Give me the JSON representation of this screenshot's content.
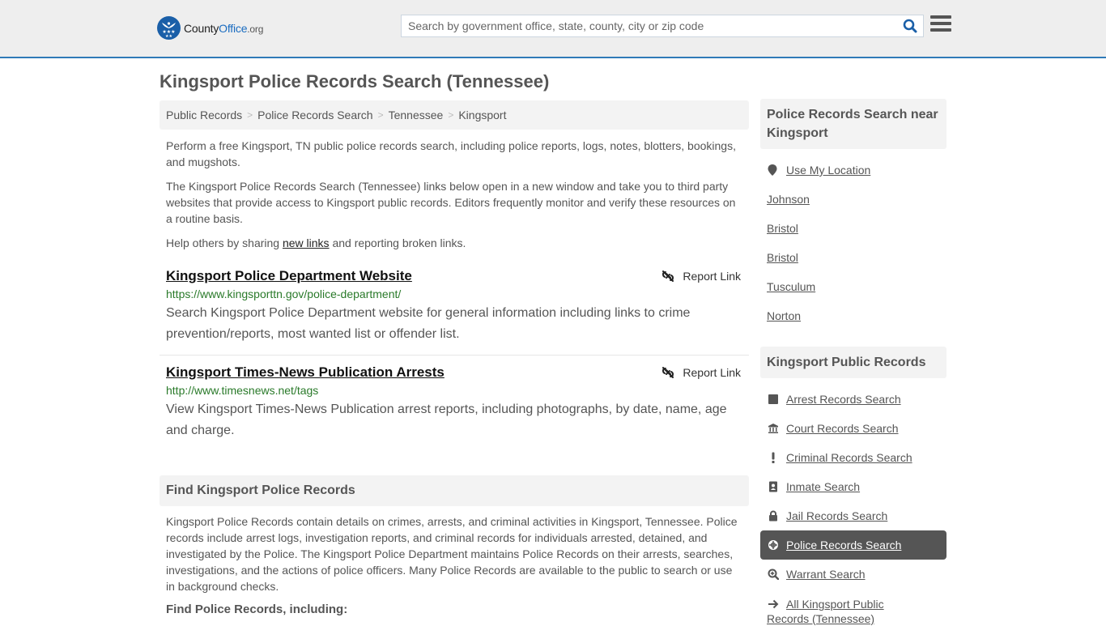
{
  "header": {
    "logo": {
      "county": "County",
      "office": "Office",
      "org": ".org"
    },
    "search": {
      "placeholder": "Search by government office, state, county, city or zip code",
      "value": ""
    },
    "brand_color": "#1a5fa8",
    "accent_border": "#2f7ab8"
  },
  "page": {
    "title": "Kingsport Police Records Search (Tennessee)"
  },
  "breadcrumb": [
    {
      "label": "Public Records"
    },
    {
      "label": "Police Records Search"
    },
    {
      "label": "Tennessee"
    },
    {
      "label": "Kingsport"
    }
  ],
  "breadcrumb_separator": ">",
  "intro": {
    "p1": "Perform a free Kingsport, TN public police records search, including police reports, logs, notes, blotters, bookings, and mugshots.",
    "p2": "The Kingsport Police Records Search (Tennessee) links below open in a new window and take you to third party websites that provide access to Kingsport public records. Editors frequently monitor and verify these resources on a routine basis.",
    "p3_before": "Help others by sharing ",
    "p3_link": "new links",
    "p3_after": " and reporting broken links."
  },
  "results": [
    {
      "title": "Kingsport Police Department Website",
      "url": "https://www.kingsporttn.gov/police-department/",
      "description": "Search Kingsport Police Department website for general information including links to crime prevention/reports, most wanted list or offender list.",
      "report_label": "Report Link"
    },
    {
      "title": "Kingsport Times-News Publication Arrests",
      "url": "http://www.timesnews.net/tags",
      "description": "View Kingsport Times-News Publication arrest reports, including photographs, by date, name, age and charge.",
      "report_label": "Report Link"
    }
  ],
  "find_section": {
    "heading": "Find Kingsport Police Records",
    "body": "Kingsport Police Records contain details on crimes, arrests, and criminal activities in Kingsport, Tennessee. Police records include arrest logs, investigation reports, and criminal records for individuals arrested, detained, and investigated by the Police. The Kingsport Police Department maintains Police Records on their arrests, searches, investigations, and the actions of police officers. Many Police Records are available to the public to search or use in background checks.",
    "subheading": "Find Police Records, including:"
  },
  "sidebar": {
    "near_heading": "Police Records Search near Kingsport",
    "use_location": "Use My Location",
    "near_items": [
      {
        "label": "Johnson"
      },
      {
        "label": "Bristol"
      },
      {
        "label": "Bristol"
      },
      {
        "label": "Tusculum"
      },
      {
        "label": "Norton"
      }
    ],
    "public_records_heading": "Kingsport Public Records",
    "public_records": [
      {
        "label": "Arrest Records Search",
        "icon": "square-icon"
      },
      {
        "label": "Court Records Search",
        "icon": "courthouse-icon"
      },
      {
        "label": "Criminal Records Search",
        "icon": "exclamation-icon"
      },
      {
        "label": "Inmate Search",
        "icon": "id-badge-icon"
      },
      {
        "label": "Jail Records Search",
        "icon": "lock-icon"
      },
      {
        "label": "Police Records Search",
        "icon": "crosshairs-icon",
        "active": true
      },
      {
        "label": "Warrant Search",
        "icon": "search-plus-icon"
      },
      {
        "label": "All Kingsport Public Records (Tennessee)",
        "icon": "arrow-right-icon"
      }
    ]
  }
}
